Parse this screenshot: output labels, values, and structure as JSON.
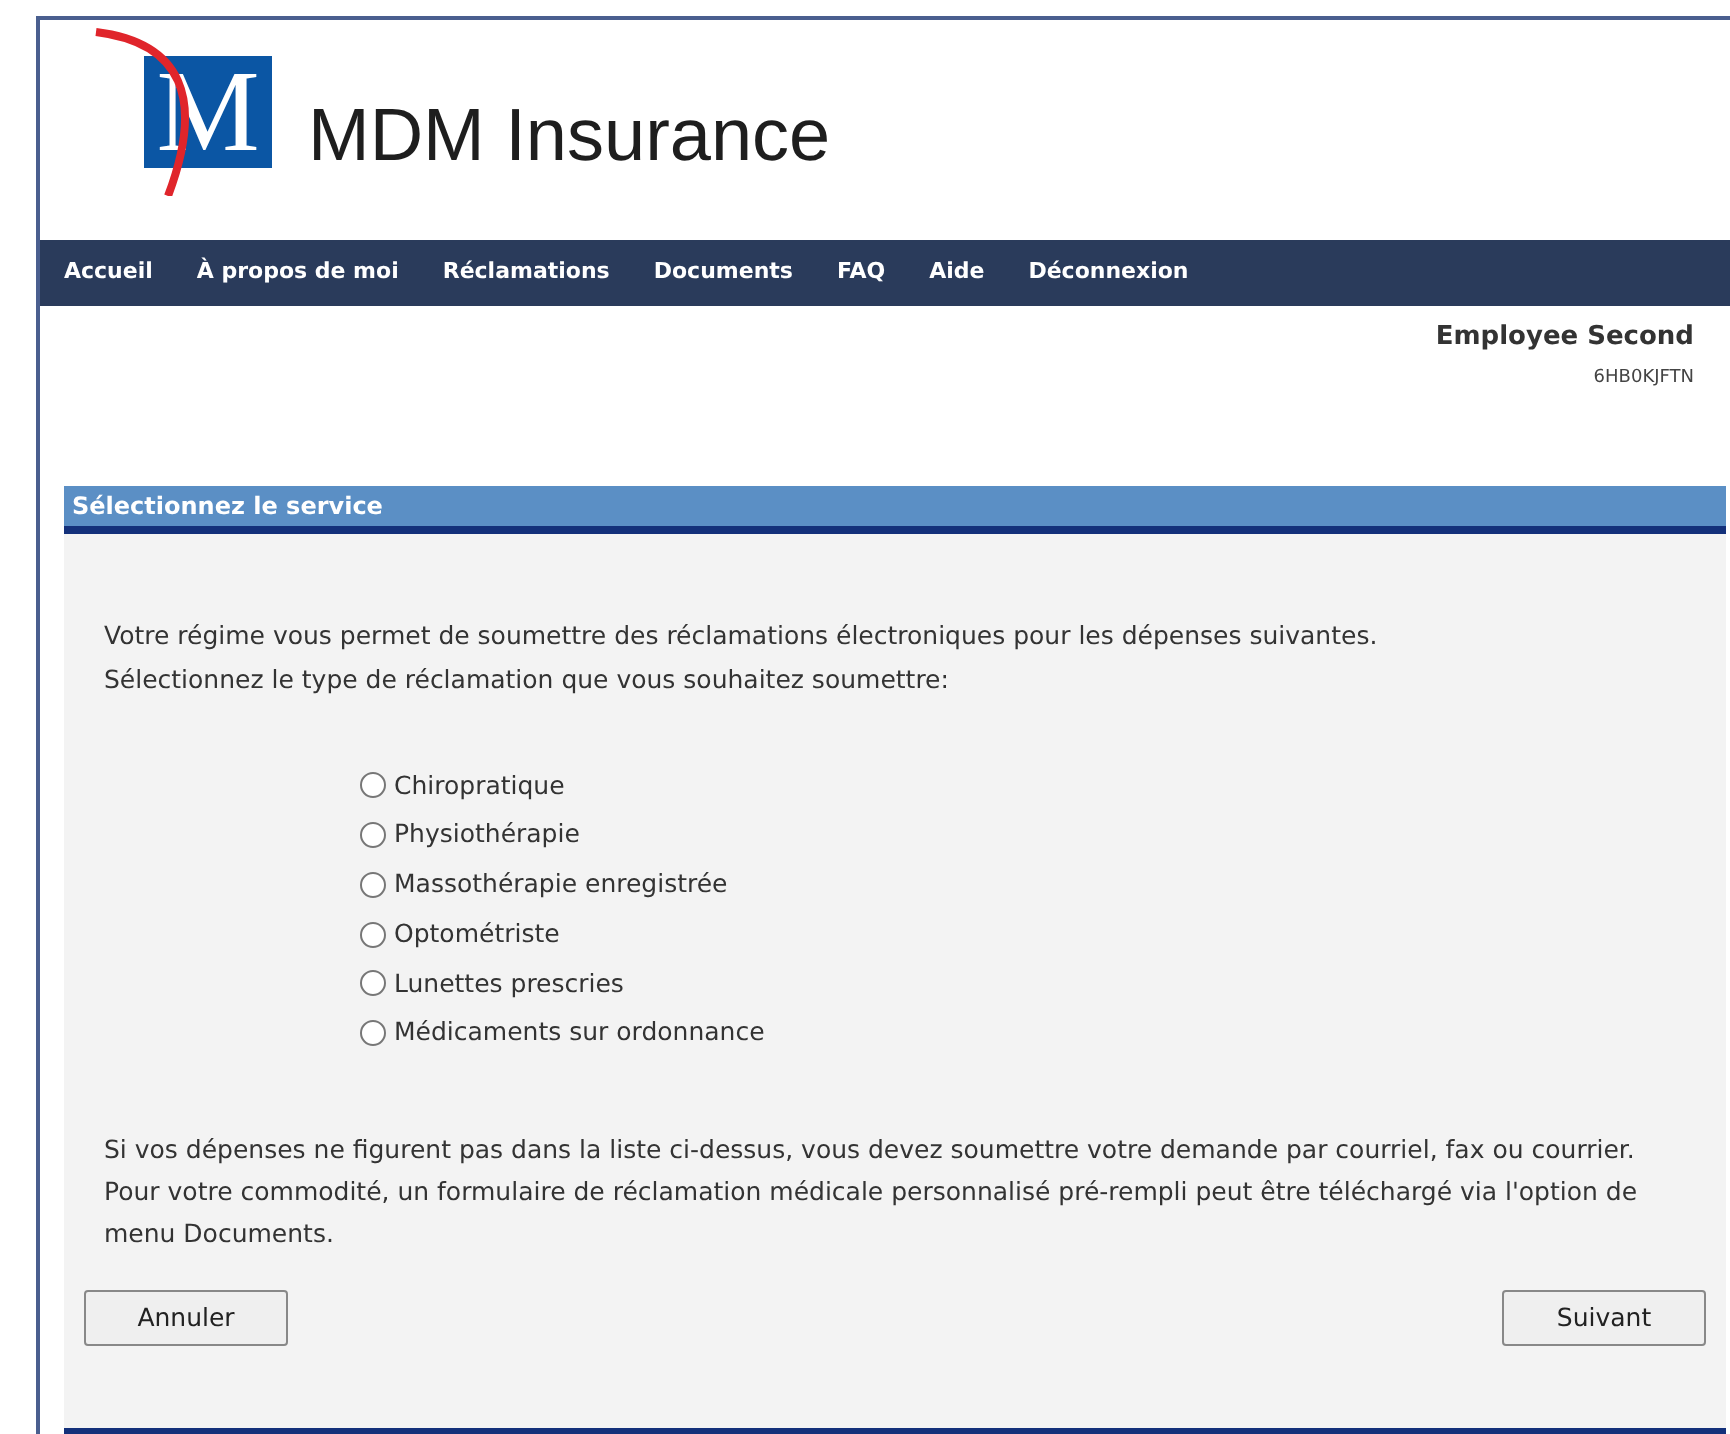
{
  "brand": {
    "mark": "M",
    "name": "MDM Insurance"
  },
  "nav": [
    "Accueil",
    "À propos de moi",
    "Réclamations",
    "Documents",
    "FAQ",
    "Aide",
    "Déconnexion"
  ],
  "user": {
    "name": "Employee Second",
    "id": "6HB0KJFTN"
  },
  "panel": {
    "title": "Sélectionnez le service",
    "intro": [
      "Votre régime vous permet de soumettre des réclamations électroniques pour les dépenses suivantes.",
      "Sélectionnez le type de réclamation que vous souhaitez soumettre:"
    ],
    "options": [
      {
        "label": "Chiropratique",
        "selected": false
      },
      {
        "label": "Physiothérapie",
        "selected": false
      },
      {
        "label": "Massothérapie enregistrée",
        "selected": false
      },
      {
        "label": "Optométriste",
        "selected": false
      },
      {
        "label": "Lunettes prescries",
        "selected": false
      },
      {
        "label": "Médicaments sur ordonnance",
        "selected": false
      }
    ],
    "note": "Si vos dépenses ne figurent pas dans la liste ci-dessus, vous devez soumettre votre demande par courriel, fax ou courrier.  Pour votre commodité, un formulaire de réclamation médicale personnalisé pré-rempli peut être téléchargé via l'option de menu Documents.",
    "buttons": [
      "Annuler",
      "Suivant"
    ]
  }
}
